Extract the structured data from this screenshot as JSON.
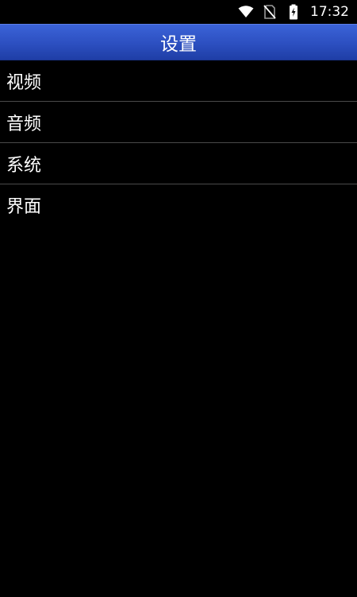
{
  "status_bar": {
    "time": "17:32",
    "icons": [
      "wifi-icon",
      "no-sim-icon",
      "battery-charging-icon"
    ]
  },
  "app_bar": {
    "title": "设置"
  },
  "menu": {
    "items": [
      {
        "label": "视频"
      },
      {
        "label": "音频"
      },
      {
        "label": "系统"
      },
      {
        "label": "界面"
      }
    ]
  },
  "colors": {
    "background": "#000000",
    "app_bar": "#2c4fc0",
    "divider": "#4a4a4a",
    "text": "#ffffff"
  }
}
